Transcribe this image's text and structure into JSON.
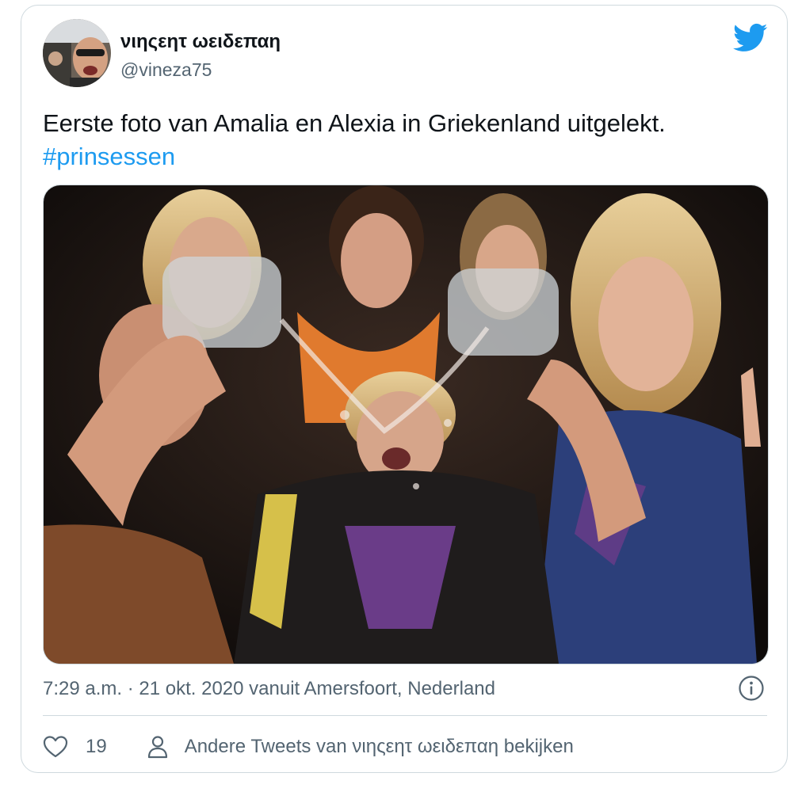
{
  "tweet": {
    "display_name": "νιηςεητ ωειδεπαη",
    "handle": "@vineza75",
    "text": "Eerste foto van Amalia en Alexia in Griekenland uitgelekt.",
    "hashtag": "#prinsessen",
    "timestamp": "7:29 a.m. · 21 okt. 2020 vanuit Amersfoort, Nederland",
    "like_count": "19",
    "more_tweets_label": "Andere Tweets van νιηςεητ ωειδεπαη bekijken"
  },
  "colors": {
    "accent": "#1d9bf0",
    "text_primary": "#0f1419",
    "text_secondary": "#536471",
    "border": "#cfd9de"
  },
  "icons": {
    "brand": "twitter-bird-icon",
    "info": "info-icon",
    "like": "heart-icon",
    "profile": "person-icon"
  }
}
